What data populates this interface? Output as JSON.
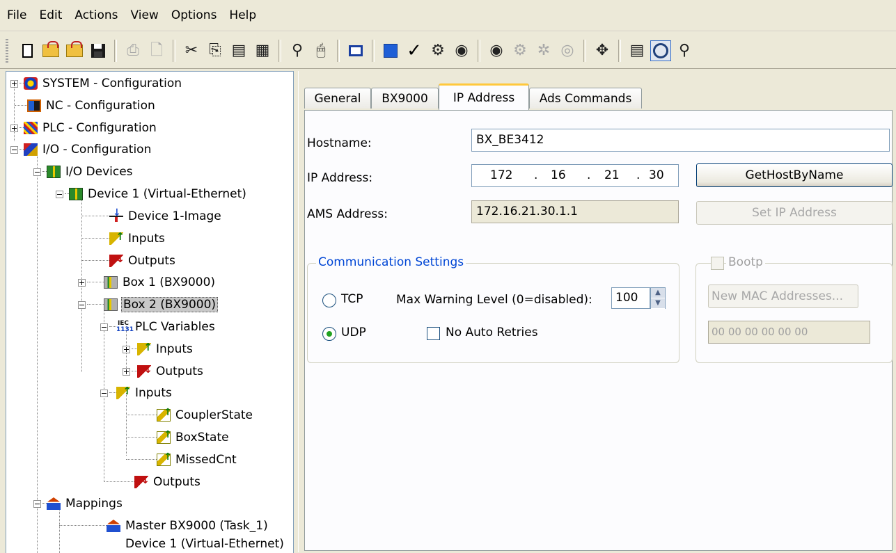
{
  "menu": [
    "File",
    "Edit",
    "Actions",
    "View",
    "Options",
    "Help"
  ],
  "toolbar": {
    "icons": [
      "new-icon",
      "open-icon",
      "open-project-icon",
      "save-icon",
      "print-icon",
      "print-preview-icon",
      "cut-icon",
      "copy-icon",
      "paste-icon",
      "paste-with-links-icon",
      "find-icon",
      "mouse-icon",
      "monitor-icon",
      "generate-mappings-icon",
      "check-configuration-icon",
      "activate-configuration-icon",
      "set-run-mode-icon",
      "restart-icon",
      "config-mode-icon",
      "reload-devices-icon",
      "scan-icon",
      "free-run-icon",
      "online-icon",
      "zoom-icon",
      "help-icon"
    ]
  },
  "tree": {
    "items": [
      {
        "label": "SYSTEM - Configuration"
      },
      {
        "label": "NC - Configuration"
      },
      {
        "label": "PLC - Configuration"
      },
      {
        "label": "I/O - Configuration"
      },
      {
        "label": "I/O Devices"
      },
      {
        "label": "Device 1 (Virtual-Ethernet)"
      },
      {
        "label": "Device 1-Image"
      },
      {
        "label": "Inputs"
      },
      {
        "label": "Outputs"
      },
      {
        "label": "Box 1 (BX9000)"
      },
      {
        "label": "Box 2 (BX9000)"
      },
      {
        "label": "PLC Variables"
      },
      {
        "label": "Inputs"
      },
      {
        "label": "Outputs"
      },
      {
        "label": "Inputs"
      },
      {
        "label": "CouplerState"
      },
      {
        "label": "BoxState"
      },
      {
        "label": "MissedCnt"
      },
      {
        "label": "Outputs"
      },
      {
        "label": "Mappings"
      },
      {
        "label": "Master BX9000 (Task_1)"
      },
      {
        "label": "Device 1 (Virtual-Ethernet)"
      }
    ],
    "iec_top": "IEC",
    "iec_bottom": "1131"
  },
  "tabs": [
    "General",
    "BX9000",
    "IP Address",
    "Ads Commands"
  ],
  "active_tab": "IP Address",
  "form": {
    "hostname_label": "Hostname:",
    "hostname_value": "BX_BE3412",
    "ip_label": "IP Address:",
    "ip_octets": [
      "172",
      "16",
      "21",
      "30"
    ],
    "ip_dot": ".",
    "ams_label": "AMS Address:",
    "ams_value": "172.16.21.30.1.1",
    "gethost_button": "GetHostByName",
    "setip_button": "Set IP Address"
  },
  "comm": {
    "legend": "Communication Settings",
    "tcp_label": "TCP",
    "udp_label": "UDP",
    "selected": "UDP",
    "max_warning_label": "Max Warning Level (0=disabled):",
    "max_warning_value": "100",
    "no_auto_retries_label": "No Auto Retries",
    "no_auto_retries_checked": false
  },
  "bootp": {
    "legend": "Bootp",
    "checked": false,
    "new_mac_button": "New MAC Addresses...",
    "mac_value": "00 00 00 00 00 00"
  },
  "colors": {
    "window_bg": "#ece9d8",
    "tab_accent": "#ffc83c",
    "legend_blue": "#0046d5",
    "radio_dot": "#21a121"
  }
}
